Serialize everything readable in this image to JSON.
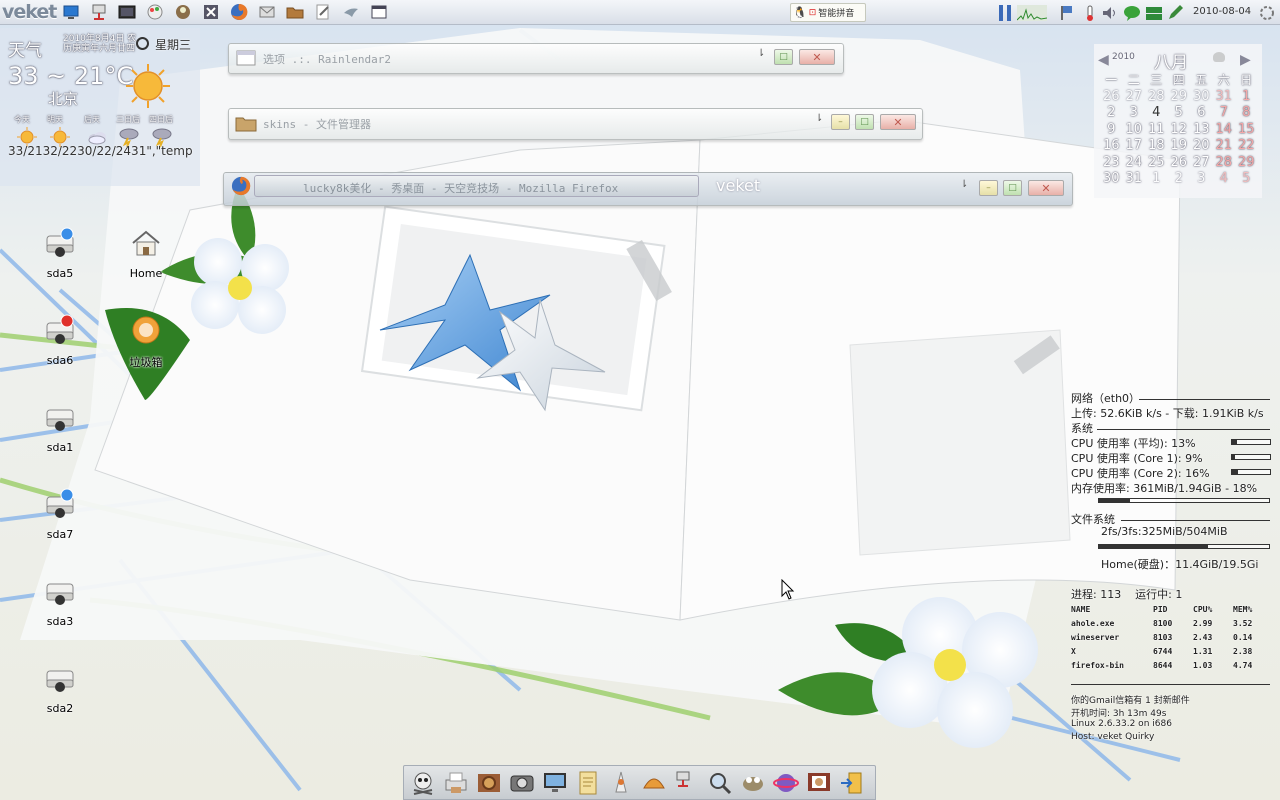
{
  "panel": {
    "logo": "veket",
    "launchers": [
      "desktop-icon",
      "network-icon",
      "terminal-icon",
      "paint-icon",
      "user-icon",
      "close-icon",
      "firefox-icon",
      "mail-icon",
      "folder-icon",
      "edit-icon",
      "bird-icon",
      "window-icon"
    ],
    "ime": {
      "label": "智能拼音"
    },
    "tray": [
      "cpu-graph-icon",
      "network-graph-icon",
      "flag-icon",
      "thermometer-icon",
      "volume-icon",
      "chat-icon",
      "network-status-icon",
      "pen-icon"
    ],
    "clock": "2010-08-04"
  },
  "weather": {
    "title": "天气",
    "date": "2010年8月4日 农历庚寅年六月廿四",
    "weekday": "星期三",
    "temp_range": "33 ~ 21°C",
    "city": "北京",
    "forecast_labels": [
      "今天",
      "明天",
      "后天",
      "三日后",
      "四日后"
    ],
    "forecast_icons": [
      "sunny-icon",
      "sunny-icon",
      "cloudy-icon",
      "storm-icon",
      "storm-icon"
    ],
    "forecast_temps": "33/2132/2230/22/2431\",\"temp"
  },
  "windows": [
    {
      "title": "选项 .:. Rainlendar2",
      "menu": "⇂"
    },
    {
      "title": "skins - 文件管理器",
      "menu": "⇂"
    },
    {
      "title": "lucky8k美化 - 秀桌面 - 天空竞技场 - Mozilla Firefox",
      "menu": "⇂",
      "label": "veket"
    }
  ],
  "window_buttons": {
    "min": "–",
    "max": "□",
    "close": "✕"
  },
  "desktop_icons": [
    {
      "label": "sda5",
      "icon": "drive-mounted-icon",
      "status": "#3a8ee8"
    },
    {
      "label": "Home",
      "icon": "home-icon"
    },
    {
      "label": "sda6",
      "icon": "drive-mounted-icon",
      "status": "#e0302b"
    },
    {
      "label": "垃圾箱",
      "icon": "trash-icon"
    },
    {
      "label": "sda1",
      "icon": "drive-icon"
    },
    {
      "label": "sda7",
      "icon": "drive-mounted-icon",
      "status": "#3a8ee8"
    },
    {
      "label": "sda3",
      "icon": "drive-icon"
    },
    {
      "label": "sda2",
      "icon": "drive-icon"
    }
  ],
  "calendar": {
    "year": "2010",
    "month": "八月",
    "weekdays": [
      "一",
      "二",
      "三",
      "四",
      "五",
      "六",
      "日"
    ],
    "rows": [
      [
        "26",
        "27",
        "28",
        "29",
        "30",
        "31",
        "1"
      ],
      [
        "2",
        "3",
        "4",
        "5",
        "6",
        "7",
        "8"
      ],
      [
        "9",
        "10",
        "11",
        "12",
        "13",
        "14",
        "15"
      ],
      [
        "16",
        "17",
        "18",
        "19",
        "20",
        "21",
        "22"
      ],
      [
        "23",
        "24",
        "25",
        "26",
        "27",
        "28",
        "29"
      ],
      [
        "30",
        "31",
        "1",
        "2",
        "3",
        "4",
        "5"
      ]
    ],
    "today": "4"
  },
  "conky": {
    "network_header": "网络（eth0）",
    "network_rates": "上传: 52.6KiB k/s - 下载: 1.91KiB k/s",
    "system_header": "系统",
    "cpu_avg": "CPU 使用率 (平均): 13%",
    "cpu_avg_value": 13,
    "cpu_core1": "CPU 使用率 (Core 1): 9%",
    "cpu_core1_value": 9,
    "cpu_core2": "CPU 使用率 (Core 2): 16%",
    "cpu_core2_value": 16,
    "memory": "内存使用率: 361MiB/1.94GiB - 18%",
    "memory_value": 18,
    "fs_header": "文件系统",
    "fs_root": "2fs/3fs:325MiB/504MiB",
    "fs_root_value": 64,
    "fs_home": "Home(硬盘)：11.4GiB/19.5Gi",
    "fs_home_value": 58,
    "processes": "进程: 113    运行中: 1",
    "proc_headers": [
      "NAME",
      "PID",
      "CPU%",
      "MEM%"
    ],
    "procs": [
      [
        "ahole.exe",
        "8100",
        "2.99",
        "3.52"
      ],
      [
        "wineserver",
        "8103",
        "2.43",
        "0.14"
      ],
      [
        "X",
        "6744",
        "1.31",
        "2.38"
      ],
      [
        "firefox-bin",
        "8644",
        "1.03",
        "4.74"
      ]
    ],
    "gmail": "你的Gmail信箱有 1 封新邮件",
    "uptime": "开机时间: 3h 13m 49s",
    "kernel": "Linux 2.6.33.2 on i686",
    "host": "Host: veket Quirky"
  },
  "dock": [
    "skull-icon",
    "printer-icon",
    "gear-icon",
    "camera-icon",
    "monitor-icon",
    "notes-icon",
    "wizard-icon",
    "shell-icon",
    "network-icon",
    "search-icon",
    "gimp-icon",
    "planet-icon",
    "slideshow-icon",
    "exit-icon"
  ]
}
